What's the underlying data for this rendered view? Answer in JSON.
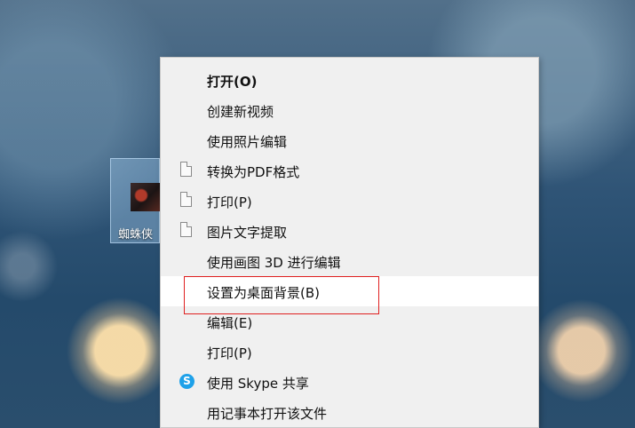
{
  "desktop": {
    "icon_label": "蜘蛛侠"
  },
  "context_menu": {
    "items": [
      {
        "label": "打开(O)",
        "icon": null
      },
      {
        "label": "创建新视频",
        "icon": null
      },
      {
        "label": "使用照片编辑",
        "icon": null
      },
      {
        "label": "转换为PDF格式",
        "icon": "document-icon"
      },
      {
        "label": "打印(P)",
        "icon": "document-icon"
      },
      {
        "label": "图片文字提取",
        "icon": "document-icon"
      },
      {
        "label": "使用画图 3D 进行编辑",
        "icon": null
      },
      {
        "label": "设置为桌面背景(B)",
        "icon": null
      },
      {
        "label": "编辑(E)",
        "icon": null
      },
      {
        "label": "打印(P)",
        "icon": null
      },
      {
        "label": "使用 Skype 共享",
        "icon": "skype-icon"
      },
      {
        "label": "用记事本打开该文件",
        "icon": null
      }
    ],
    "skype_glyph": "S",
    "highlight_color": "#ffffff",
    "annotation_color": "#e02020"
  }
}
